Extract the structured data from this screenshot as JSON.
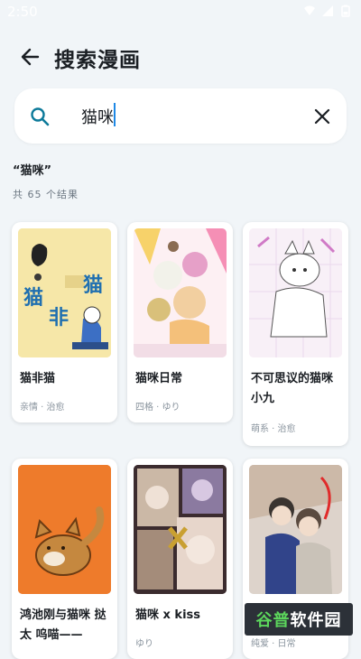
{
  "status_bar": {
    "time": "2:50",
    "icons": [
      "wifi-icon",
      "signal-icon",
      "battery-icon"
    ]
  },
  "header": {
    "title": "搜索漫画",
    "back_icon": "arrow-left-icon"
  },
  "search": {
    "value": "猫咪",
    "search_icon": "search-icon",
    "clear_icon": "close-icon"
  },
  "results": {
    "query_label": "“猫咪”",
    "count_text": "共 65 个结果"
  },
  "cards": [
    {
      "title": "猫非猫",
      "tags": "亲情 · 治愈",
      "cover_text": [
        "猫",
        "非",
        "猫"
      ]
    },
    {
      "title": "猫咪日常",
      "tags": "四格 · ゆり"
    },
    {
      "title": "不可思议的猫咪 小九",
      "tags": "萌系 · 治愈"
    },
    {
      "title": "鸿池刚与猫咪 挞太 呜喵——",
      "tags": ""
    },
    {
      "title": "猫咪 x kiss",
      "tags": "ゆり"
    },
    {
      "title": "",
      "tags": "纯爱 · 日常"
    }
  ],
  "watermark": {
    "part1": "谷普",
    "part2": "软件园"
  },
  "colors": {
    "background": "#f1f5f8",
    "accent": "#1e88e5",
    "card": "#ffffff"
  }
}
